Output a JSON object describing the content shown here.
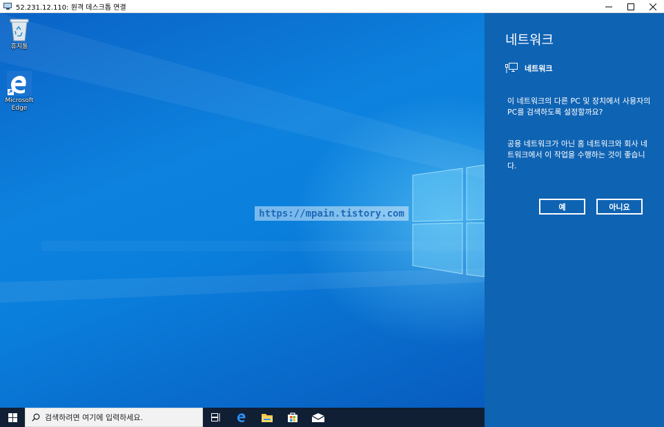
{
  "window": {
    "title": "52.231.12.110: 원격 데스크톱 연결",
    "icon": "remote-desktop-icon",
    "controls": [
      "minimize-icon",
      "maximize-icon",
      "close-icon"
    ]
  },
  "desktop": {
    "icons": [
      {
        "label": "휴지통",
        "icon": "recycle-bin-icon"
      },
      {
        "label_line1": "Microsoft",
        "label_line2": "Edge",
        "icon": "edge-icon"
      }
    ],
    "watermark": "https://mpain.tistory.com"
  },
  "taskbar": {
    "search_placeholder": "검색하려면 여기에 입력하세요.",
    "icons": [
      "windows-start-icon",
      "task-view-icon",
      "edge-icon",
      "file-explorer-icon",
      "store-icon",
      "mail-icon"
    ]
  },
  "network_flyout": {
    "heading": "네트워크",
    "network_name": "네트워크",
    "question": "이 네트워크의 다른 PC 및 장치에서 사용자의 PC를 검색하도록 설정할까요?",
    "recommendation": "공용 네트워크가 아닌 홈 네트워크와 회사 네트워크에서 이 작업을 수행하는 것이 좋습니다.",
    "yes_label": "예",
    "no_label": "아니요"
  },
  "colors": {
    "flyout_bg": "#0f63b3",
    "taskbar_bg": "#101f33",
    "desktop_accent": "#0a7fdc"
  }
}
